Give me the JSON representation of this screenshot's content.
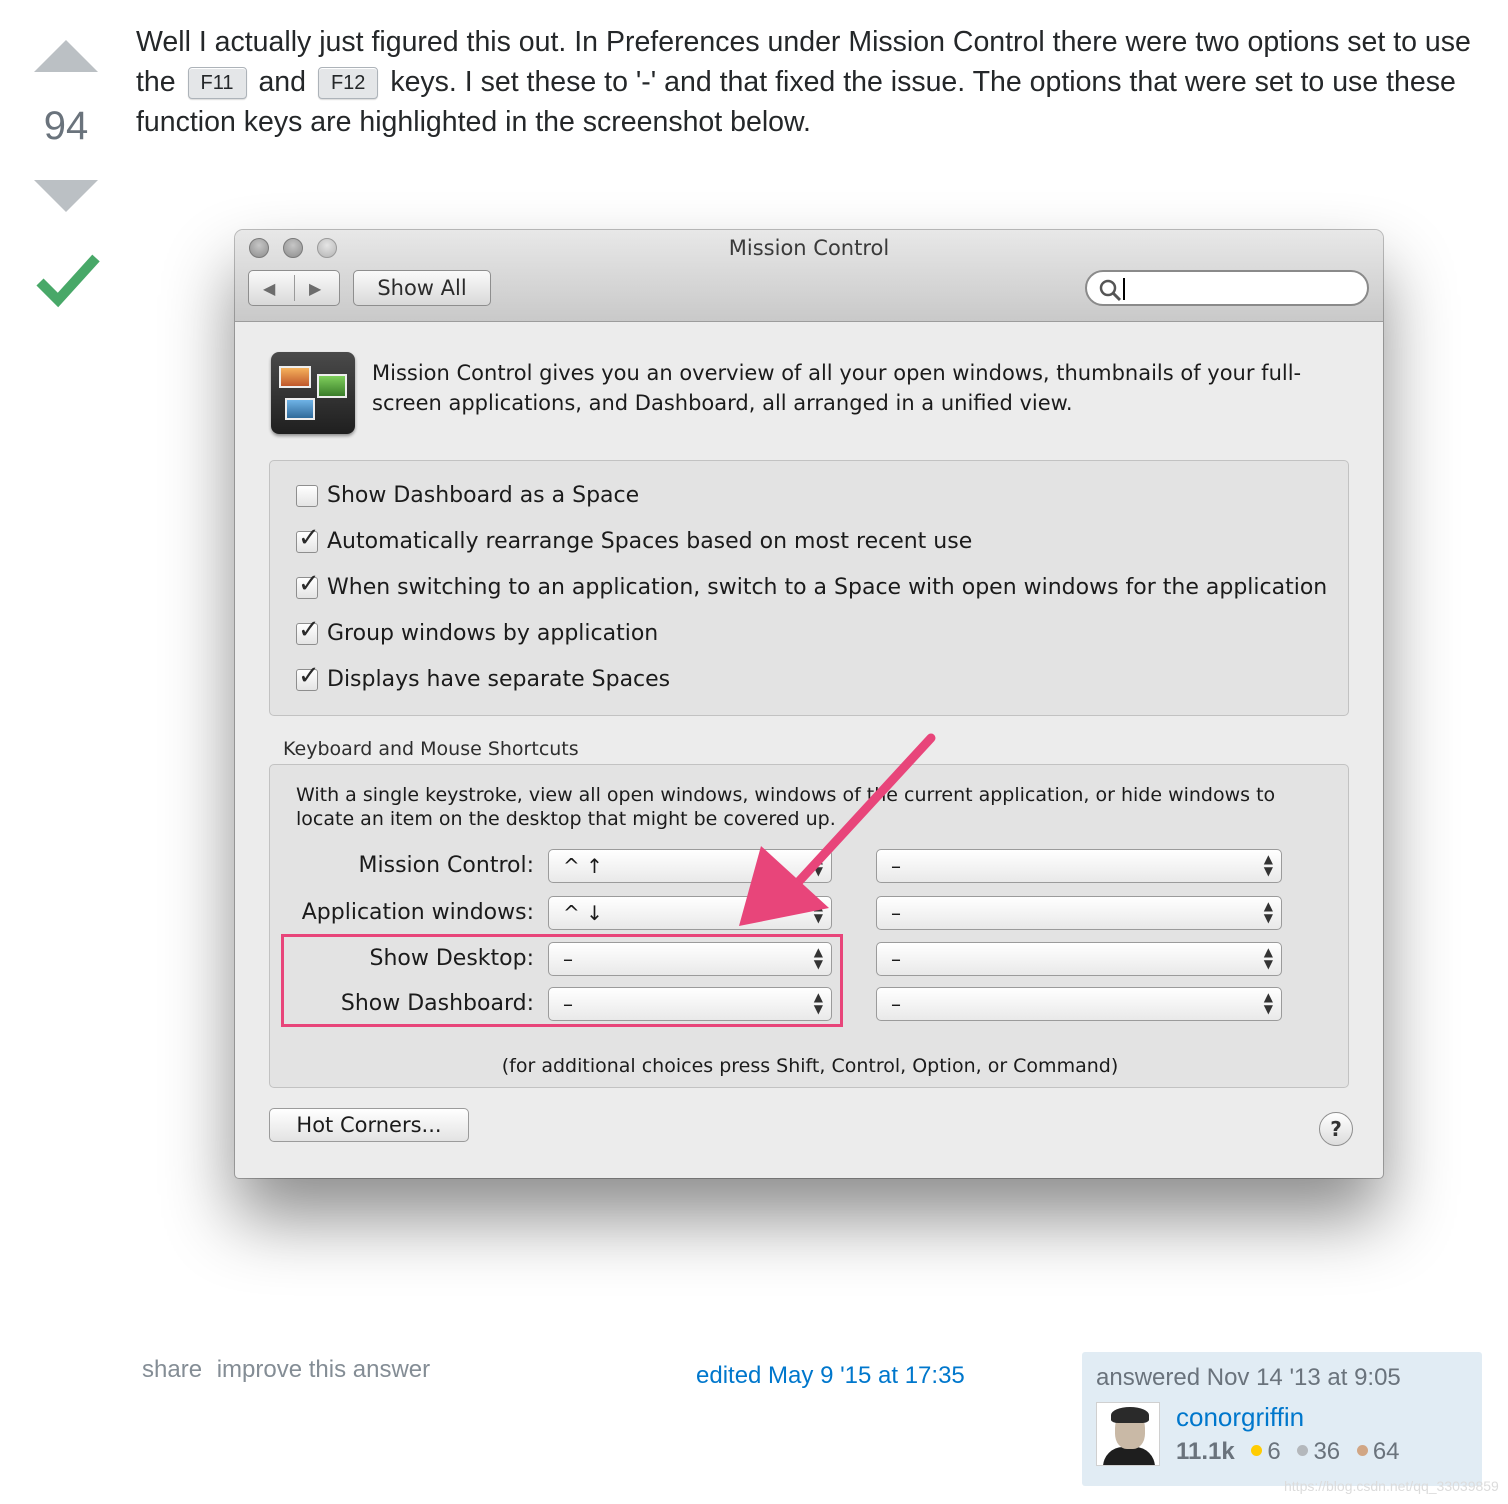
{
  "vote": {
    "count": "94"
  },
  "post": {
    "text_1": "Well I actually just figured this out. In Preferences under Mission Control there were two options set to use the",
    "kbd_1": "F11",
    "text_2": "and",
    "kbd_2": "F12",
    "text_3": "keys. I set these to '-' and that fixed the issue. The options that were set to use these function keys are highlighted in the screenshot below."
  },
  "window": {
    "title": "Mission Control",
    "show_all": "Show All",
    "intro": "Mission Control gives you an overview of all your open windows, thumbnails of your full-screen applications, and Dashboard, all arranged in a unified view.",
    "options": [
      {
        "label": "Show Dashboard as a Space",
        "checked": false
      },
      {
        "label": "Automatically rearrange Spaces based on most recent use",
        "checked": true
      },
      {
        "label": "When switching to an application, switch to a Space with open windows for the application",
        "checked": true
      },
      {
        "label": "Group windows by application",
        "checked": true
      },
      {
        "label": "Displays have separate Spaces",
        "checked": true
      }
    ],
    "shortcuts_title": "Keyboard and Mouse Shortcuts",
    "shortcuts_desc": "With a single keystroke, view all open windows, windows of the current application, or hide windows to locate an item on the desktop that might be covered up.",
    "shortcuts": [
      {
        "label": "Mission Control:",
        "key": "^ ↑",
        "mouse": "–"
      },
      {
        "label": "Application windows:",
        "key": "^ ↓",
        "mouse": "–"
      },
      {
        "label": "Show Desktop:",
        "key": "–",
        "mouse": "–"
      },
      {
        "label": "Show Dashboard:",
        "key": "–",
        "mouse": "–"
      }
    ],
    "footnote": "(for additional choices press Shift, Control, Option, or Command)",
    "hot_corners": "Hot Corners...",
    "help": "?",
    "highlight_color": "#e8457a"
  },
  "footer": {
    "share": "share",
    "improve": "improve this answer",
    "edited": "edited May 9 '15 at 17:35",
    "answered": "answered Nov 14 '13 at 9:05",
    "username": "conorgriffin",
    "reputation": "11.1k",
    "gold": "6",
    "silver": "36",
    "bronze": "64",
    "watermark": "https://blog.csdn.net/qq_33039859"
  },
  "colors": {
    "link": "#0077cc",
    "accepted": "#48a868",
    "vote_arrow": "#bbc0c4"
  }
}
